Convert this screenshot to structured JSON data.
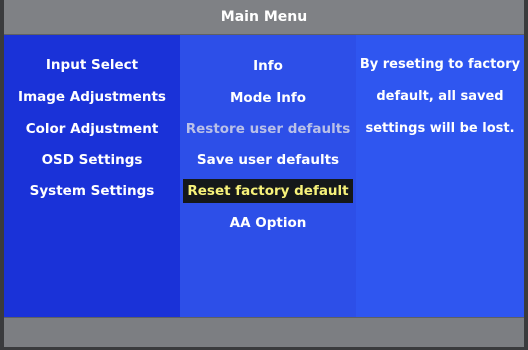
{
  "menu": {
    "title": "Main Menu",
    "left_items": [
      {
        "label": "Input Select"
      },
      {
        "label": "Image Adjustments"
      },
      {
        "label": "Color Adjustment"
      },
      {
        "label": "OSD Settings"
      },
      {
        "label": "System Settings"
      }
    ],
    "mid_items": [
      {
        "label": "Info",
        "state": "normal"
      },
      {
        "label": "Mode Info",
        "state": "normal"
      },
      {
        "label": "Restore user defaults",
        "state": "disabled"
      },
      {
        "label": "Save user defaults",
        "state": "normal"
      },
      {
        "label": "Reset factory default",
        "state": "selected"
      },
      {
        "label": "AA Option",
        "state": "normal"
      }
    ],
    "help_lines": [
      "By reseting to factory",
      "default, all saved",
      "settings will be lost."
    ]
  },
  "colors": {
    "panel_blue": "#1a32d8",
    "mid_blue": "#2d4fe8",
    "right_blue": "#2f56f0",
    "title_gray": "#7f8185",
    "highlight_bg": "#15181a",
    "highlight_text": "#f7f27a"
  }
}
